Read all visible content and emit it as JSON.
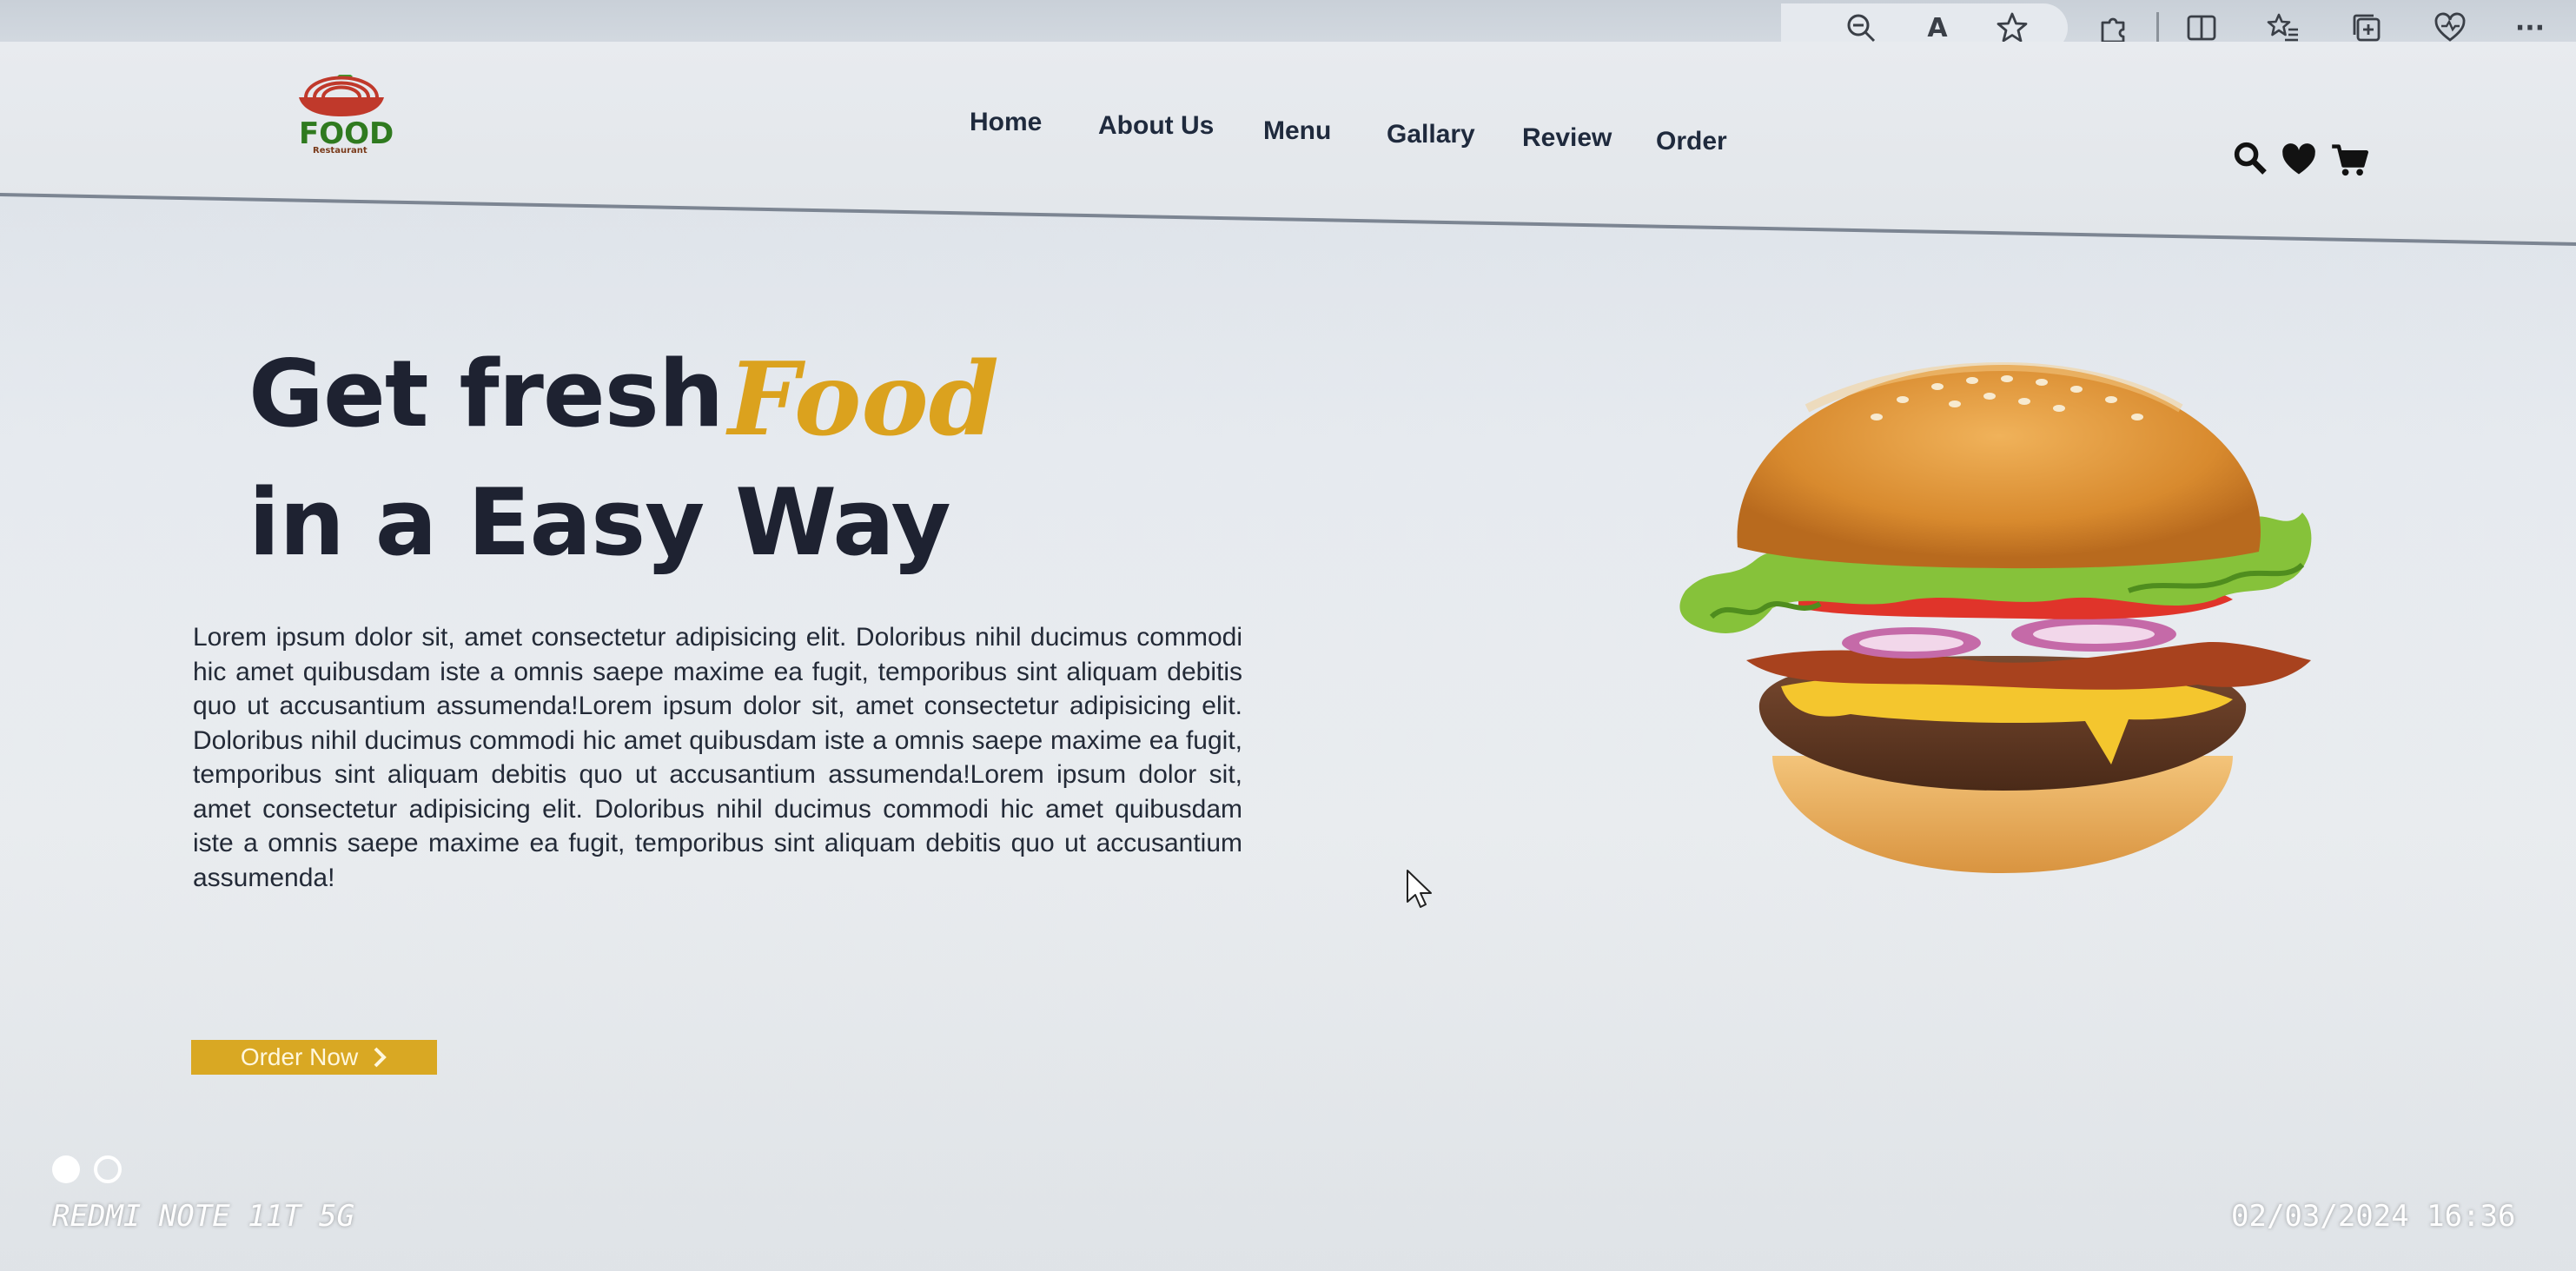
{
  "browser": {
    "more_label": "···",
    "read_aloud_label": "A"
  },
  "site": {
    "logo_text": "FOOD",
    "logo_sub": "Restaurant",
    "nav": [
      {
        "label": "Home"
      },
      {
        "label": "About Us"
      },
      {
        "label": "Menu"
      },
      {
        "label": "Gallary"
      },
      {
        "label": "Review"
      },
      {
        "label": "Order"
      }
    ]
  },
  "hero": {
    "line1": "Get fresh",
    "highlight": "Food",
    "line2": "in a Easy Way",
    "paragraph": "Lorem ipsum dolor sit, amet consectetur adipisicing elit. Doloribus nihil ducimus commodi hic amet quibusdam iste a omnis saepe maxime ea fugit, temporibus sint aliquam debitis quo ut accusantium assumenda!Lorem ipsum dolor sit, amet consectetur adipisicing elit. Doloribus nihil ducimus commodi hic amet quibusdam iste a omnis saepe maxime ea fugit, temporibus sint aliquam debitis quo ut accusantium assumenda!Lorem ipsum dolor sit, amet consectetur adipisicing elit. Doloribus nihil ducimus commodi hic amet quibusdam iste a omnis saepe maxime ea fugit, temporibus sint aliquam debitis quo ut accusantium assumenda!",
    "button_label": "Order Now"
  },
  "overlay": {
    "device": "REDMI NOTE 11T 5G",
    "timestamp": "02/03/2024  16:36"
  },
  "colors": {
    "accent": "#dba21e",
    "heading": "#1e2231",
    "logo_green": "#2f7a1f",
    "logo_red": "#c0392b"
  },
  "icons": [
    "zoom-out-icon",
    "read-aloud-icon",
    "favorite-star-icon",
    "extensions-icon",
    "split-screen-icon",
    "favorites-icon",
    "collections-icon",
    "browser-essentials-icon",
    "more-icon",
    "search-icon",
    "heart-icon",
    "cart-icon",
    "burger-image",
    "mouse-cursor-icon",
    "chevron-right-icon"
  ]
}
